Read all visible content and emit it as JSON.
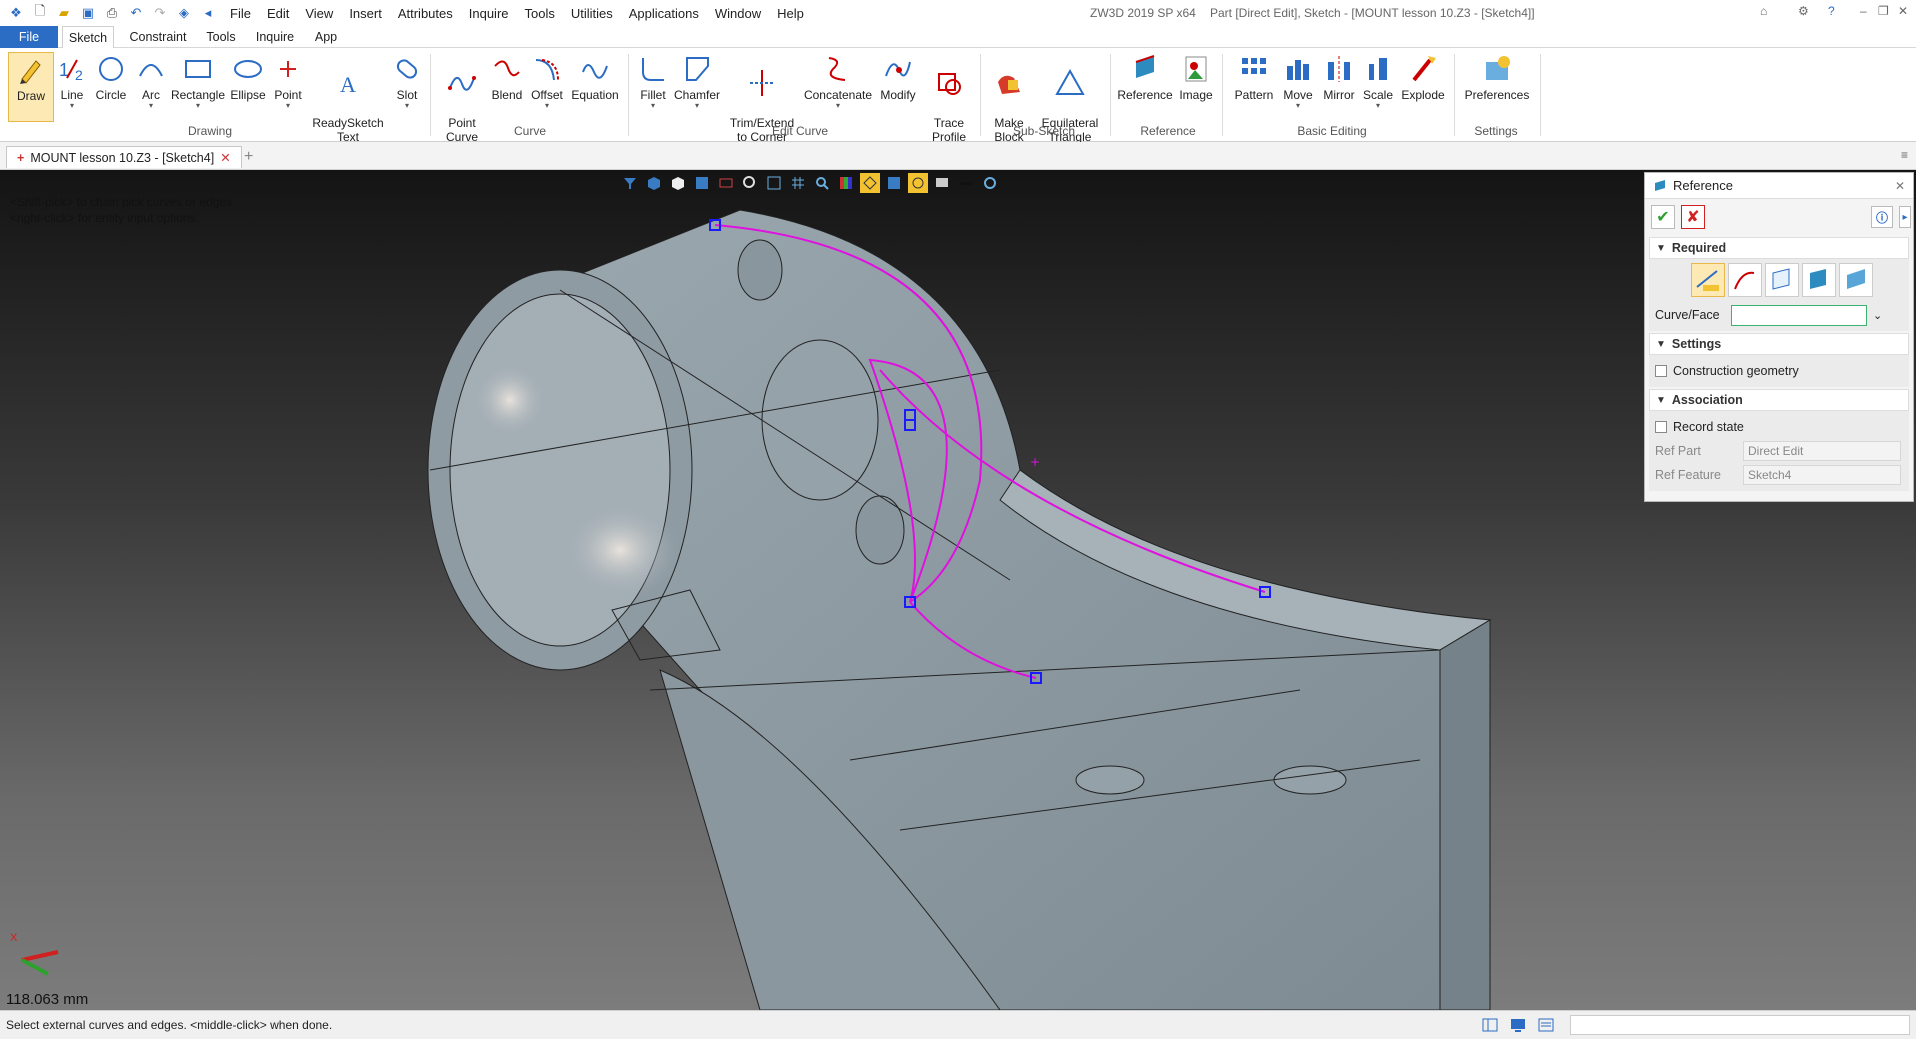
{
  "titlebar": {
    "menus": [
      "File",
      "Edit",
      "View",
      "Insert",
      "Attributes",
      "Inquire",
      "Tools",
      "Utilities",
      "Applications",
      "Window",
      "Help"
    ],
    "app_title": "ZW3D 2019 SP x64",
    "doc_title": "Part [Direct Edit],  Sketch - [MOUNT lesson 10.Z3 - [Sketch4]]"
  },
  "ribbon_tabs": [
    "File",
    "Sketch",
    "Constraint",
    "Tools",
    "Inquire",
    "App"
  ],
  "ribbon": {
    "drawing": {
      "label": "Drawing",
      "buttons": [
        "Draw",
        "Line",
        "Circle",
        "Arc",
        "Rectangle",
        "Ellipse",
        "Point",
        "ReadySketch\nText",
        "Slot"
      ]
    },
    "curve": {
      "label": "Curve",
      "buttons": [
        "Point\nCurve",
        "Blend",
        "Offset",
        "Equation"
      ]
    },
    "edit_curve": {
      "label": "Edit Curve",
      "buttons": [
        "Fillet",
        "Chamfer",
        "Trim/Extend\nto Corner",
        "Concatenate",
        "Modify",
        "Trace\nProfile"
      ]
    },
    "sub_sketch": {
      "label": "Sub-Sketch",
      "buttons": [
        "Make\nBlock",
        "Equilateral\nTriangle"
      ]
    },
    "reference": {
      "label": "Reference",
      "buttons": [
        "Reference",
        "Image"
      ]
    },
    "basic_editing": {
      "label": "Basic Editing",
      "buttons": [
        "Pattern",
        "Move",
        "Mirror",
        "Scale",
        "Explode"
      ]
    },
    "settings": {
      "label": "Settings",
      "buttons": [
        "Preferences"
      ]
    }
  },
  "doc_tab": {
    "label": "MOUNT lesson 10.Z3 - [Sketch4]"
  },
  "viewport": {
    "hint_line1": "<Shift-pick> to chain pick curves or edges.",
    "hint_line2": "<right-click> for entity input options.",
    "measurement": "118.063 mm",
    "triad_x": "X",
    "colors": {
      "sketch_curve": "#e010e0",
      "handle": "#1a1aff",
      "model": "#8e9aa2"
    }
  },
  "ref_panel": {
    "title": "Reference",
    "required_label": "Required",
    "curve_face_label": "Curve/Face",
    "curve_face_value": "",
    "settings_label": "Settings",
    "construction_label": "Construction geometry",
    "association_label": "Association",
    "record_state_label": "Record state",
    "ref_part_label": "Ref Part",
    "ref_part_value": "Direct Edit",
    "ref_feature_label": "Ref Feature",
    "ref_feature_value": "Sketch4"
  },
  "status": {
    "message": "Select external curves and edges.  <middle-click> when done."
  }
}
